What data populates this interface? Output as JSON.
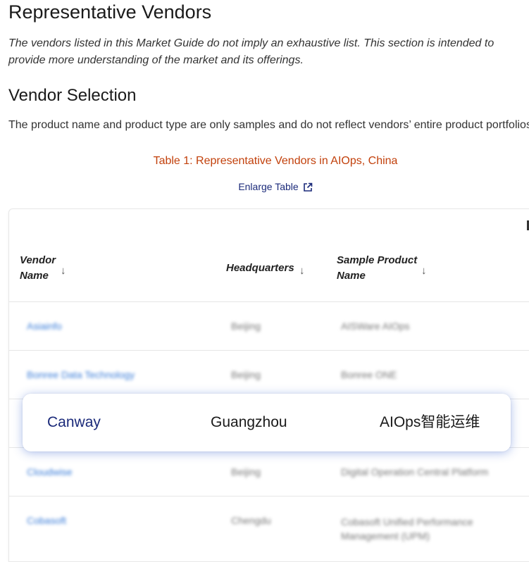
{
  "heading": "Representative Vendors",
  "intro": "The vendors listed in this Market Guide do not imply an exhaustive list. This section is intended to provide more understanding of the market and its offerings.",
  "subheading": "Vendor Selection",
  "description": "The product name and product type are only samples and do not reflect vendors’ entire product portfolios.",
  "table_caption": "Table 1: Representative Vendors in AIOps, China",
  "enlarge_label": "Enlarge Table",
  "columns": {
    "vendor": "Vendor Name",
    "hq": "Headquarters",
    "product": "Sample Product Name"
  },
  "rows": [
    {
      "vendor": "Asiainfo",
      "hq": "Beijing",
      "product": "AISWare AIOps"
    },
    {
      "vendor": "Bonree Data Technology",
      "hq": "Beijing",
      "product": "Bonree ONE"
    },
    {
      "vendor": "Canway",
      "hq": "Guangzhou",
      "product": "AIOps智能运维"
    },
    {
      "vendor": "Cloudwise",
      "hq": "Beijing",
      "product": "Digital Operation Central Platform"
    },
    {
      "vendor": "Cobasoft",
      "hq": "Chengdu",
      "product": "Cobasoft Unified Performance Management (UPM)"
    }
  ],
  "colors": {
    "caption": "#c2410c",
    "link": "#1b2a7a",
    "highlight_glow": "#466ed2"
  }
}
